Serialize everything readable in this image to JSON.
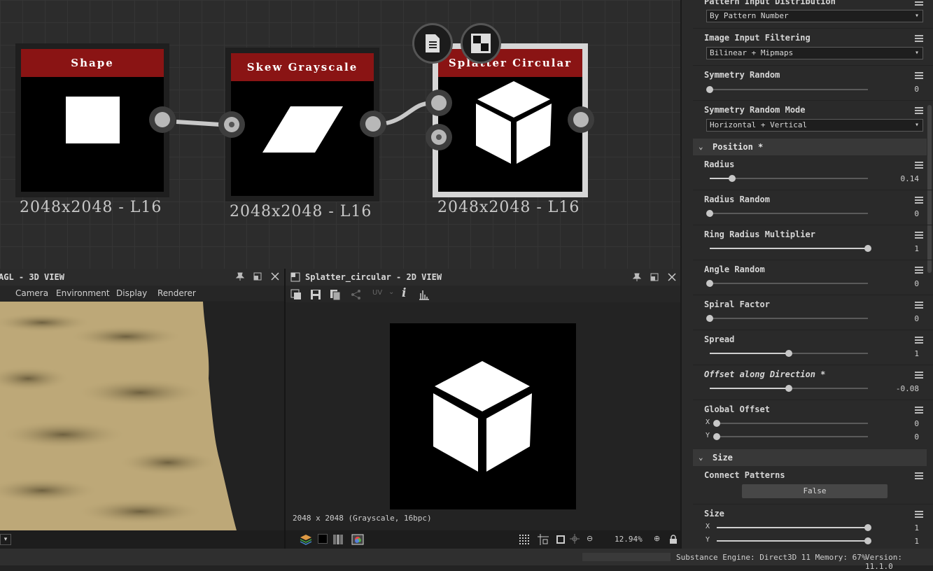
{
  "graph": {
    "nodes": [
      {
        "title": "Shape",
        "resolution": "2048x2048 - L16"
      },
      {
        "title": "Skew Grayscale",
        "resolution": "2048x2048 - L16"
      },
      {
        "title": "Splatter Circular",
        "resolution": "2048x2048 - L16"
      }
    ]
  },
  "view3d": {
    "title": "AGL - 3D VIEW",
    "menu": [
      "Camera",
      "Environment",
      "Display",
      "Renderer"
    ]
  },
  "view2d": {
    "title": "Splatter_circular - 2D VIEW",
    "uv_label": "UV",
    "info": "2048 x 2048 (Grayscale, 16bpc)",
    "zoom": "12.94%"
  },
  "status": {
    "engine": "Substance Engine: Direct3D 11 Memory: 67%",
    "version": "Version: 11.1.0"
  },
  "props": {
    "pattern_input_distribution": {
      "label": "Pattern Input Distribution",
      "value": "By Pattern Number"
    },
    "image_input_filtering": {
      "label": "Image Input Filtering",
      "value": "Bilinear + Mipmaps"
    },
    "symmetry_random": {
      "label": "Symmetry Random",
      "value": "0",
      "level": 0
    },
    "symmetry_random_mode": {
      "label": "Symmetry Random Mode",
      "value": "Horizontal + Vertical"
    },
    "position_section": "Position *",
    "radius": {
      "label": "Radius",
      "value": "0.14",
      "level": 0.14
    },
    "radius_random": {
      "label": "Radius Random",
      "value": "0",
      "level": 0
    },
    "ring_radius_multiplier": {
      "label": "Ring Radius Multiplier",
      "value": "1",
      "level": 1
    },
    "angle_random": {
      "label": "Angle Random",
      "value": "0",
      "level": 0
    },
    "spiral_factor": {
      "label": "Spiral Factor",
      "value": "0",
      "level": 0
    },
    "spread": {
      "label": "Spread",
      "value": "1",
      "level": 0.5
    },
    "offset_along_direction": {
      "label": "Offset along Direction *",
      "value": "-0.08",
      "level": 0.5
    },
    "global_offset": {
      "label": "Global Offset",
      "x_label": "X",
      "x": "0",
      "x_level": 0,
      "y_label": "Y",
      "y": "0",
      "y_level": 0
    },
    "size_section": "Size",
    "connect_patterns": {
      "label": "Connect Patterns",
      "value": "False"
    },
    "size": {
      "label": "Size",
      "x_label": "X",
      "x": "1",
      "x_level": 1,
      "y_label": "Y",
      "y": "1",
      "y_level": 1
    }
  }
}
